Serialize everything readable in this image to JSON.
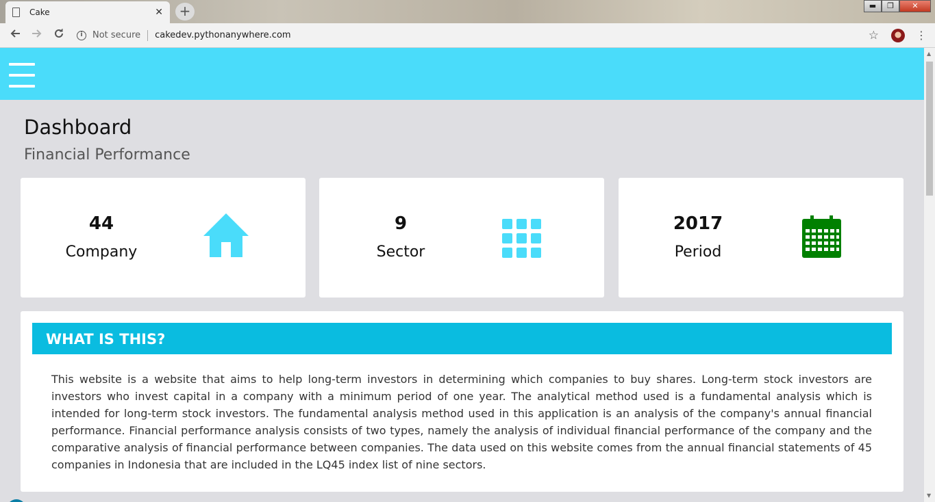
{
  "browser": {
    "tab_title": "Cake",
    "tab_close": "✕",
    "new_tab": "+",
    "security_label": "Not secure",
    "url": "cakedev.pythonanywhere.com",
    "window_buttons": {
      "minimize": "▬",
      "maximize": "❐",
      "close": "✕"
    }
  },
  "header": {
    "title": "Dashboard",
    "subtitle": "Financial Performance",
    "accent_color": "#4adcfa"
  },
  "stats": [
    {
      "value": "44",
      "label": "Company",
      "icon": "home-icon",
      "icon_color": "#4adcfa"
    },
    {
      "value": "9",
      "label": "Sector",
      "icon": "grid-icon",
      "icon_color": "#4adcfa"
    },
    {
      "value": "2017",
      "label": "Period",
      "icon": "calendar-icon",
      "icon_color": "#008000"
    }
  ],
  "info": {
    "heading": "WHAT IS THIS?",
    "header_color": "#0abce0",
    "body": "This website is a website that aims to help long-term investors in determining which companies to buy shares. Long-term stock investors are investors who invest capital in a company with a minimum period of one year. The analytical method used is a fundamental analysis which is intended for long-term stock investors. The fundamental analysis method used in this application is an analysis of the company's annual financial performance. Financial performance analysis consists of two types, namely the analysis of individual financial performance of the company and the comparative analysis of financial performance between companies. The data used on this website comes from the annual financial statements of 45 companies in Indonesia that are included in the LQ45 index list of nine sectors."
  }
}
